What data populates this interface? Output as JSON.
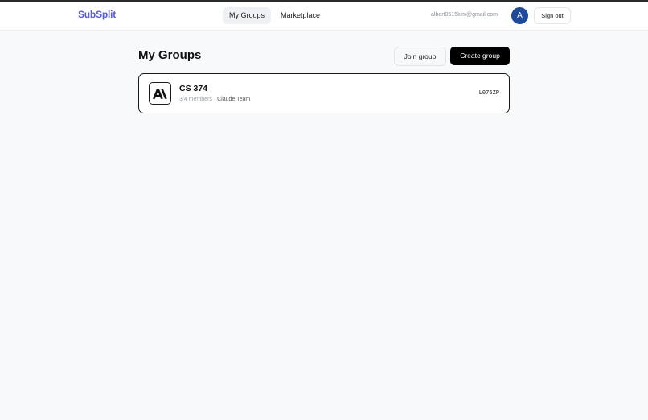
{
  "app": {
    "brand": "SubSplit"
  },
  "nav": {
    "tabs": [
      {
        "label": "My Groups",
        "active": true
      },
      {
        "label": "Marketplace",
        "active": false
      }
    ]
  },
  "user": {
    "email": "albert0515kim@gmail.com",
    "avatar_initial": "A",
    "avatar_color": "#1f4a9a",
    "sign_out_label": "Sign out"
  },
  "main": {
    "title": "My Groups",
    "join_label": "Join group",
    "create_label": "Create group",
    "groups": [
      {
        "logo_icon": "anthropic-logo-icon",
        "name": "CS 374",
        "members": "3/4 members",
        "separator": " · ",
        "plan": "Claude Team",
        "code": "L076ZP"
      }
    ]
  },
  "colors": {
    "brand": "#5b5bd6",
    "primary_button": "#000000",
    "background": "#f8f9fb"
  }
}
